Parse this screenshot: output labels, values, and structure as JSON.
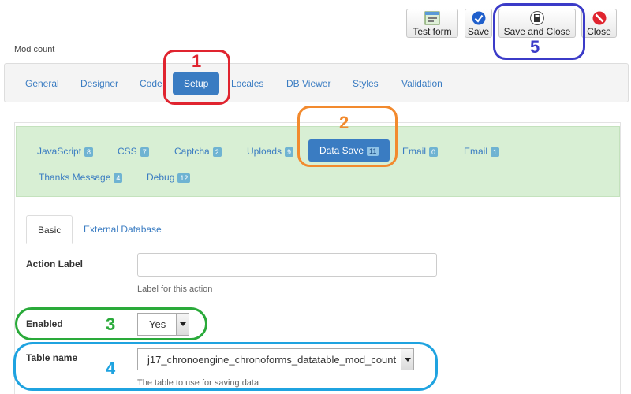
{
  "toolbar": {
    "test_form": "Test form",
    "save": "Save",
    "save_close": "Save and Close",
    "close": "Close"
  },
  "form_title": "Mod count",
  "top_tabs": [
    "General",
    "Designer",
    "Code",
    "Setup",
    "Locales",
    "DB Viewer",
    "Styles",
    "Validation"
  ],
  "sub_tabs": [
    {
      "label": "JavaScript",
      "count": "8"
    },
    {
      "label": "CSS",
      "count": "7"
    },
    {
      "label": "Captcha",
      "count": "2"
    },
    {
      "label": "Uploads",
      "count": "9"
    },
    {
      "label": "Data Save",
      "count": "11"
    },
    {
      "label": "Email",
      "count": "0"
    },
    {
      "label": "Email",
      "count": "1"
    },
    {
      "label": "Thanks Message",
      "count": "4"
    },
    {
      "label": "Debug",
      "count": "12"
    }
  ],
  "inner_tabs": [
    "Basic",
    "External Database"
  ],
  "fields": {
    "action_label": {
      "label": "Action Label",
      "value": "",
      "help": "Label for this action"
    },
    "enabled": {
      "label": "Enabled",
      "value": "Yes"
    },
    "table_name": {
      "label": "Table name",
      "value": "j17_chronoengine_chronoforms_datatable_mod_count",
      "help": "The table to use for saving data"
    }
  },
  "annotations": {
    "n1": "1",
    "n2": "2",
    "n3": "3",
    "n4": "4",
    "n5": "5",
    "colors": {
      "red": "#e0242f",
      "orange": "#f28a2e",
      "green": "#2aaa3a",
      "blue": "#1fa3e0",
      "indigo": "#3b3bc8"
    }
  }
}
